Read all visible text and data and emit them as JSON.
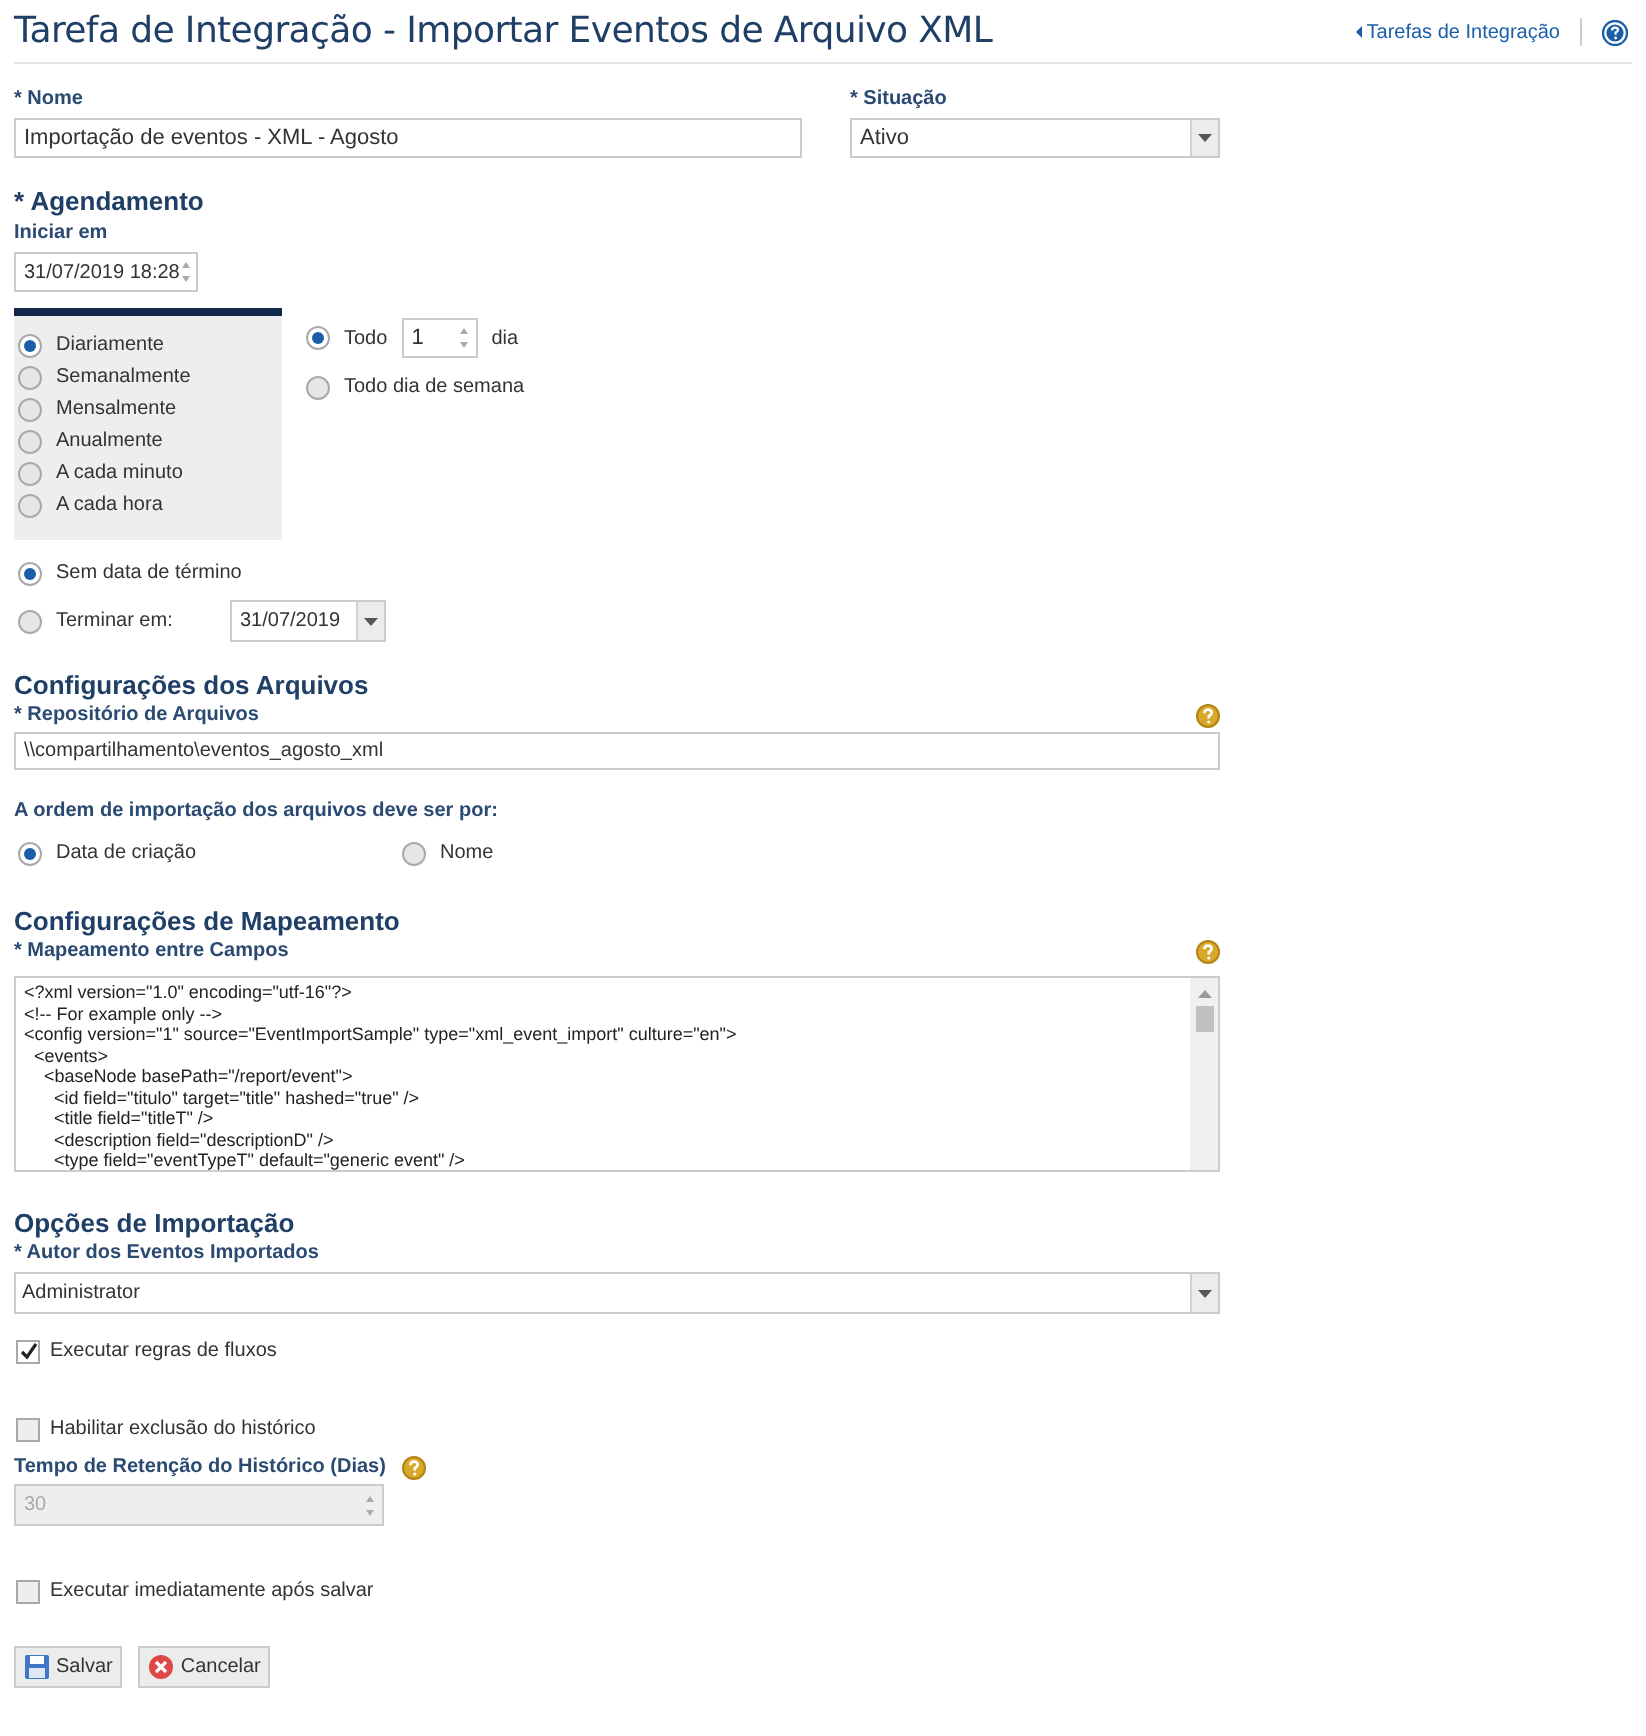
{
  "header": {
    "title": "Tarefa de Integração - Importar Eventos de Arquivo XML",
    "back_link": "Tarefas de Integração"
  },
  "name_field": {
    "label": "* Nome",
    "value": "Importação de eventos - XML - Agosto"
  },
  "status_field": {
    "label": "* Situação",
    "value": "Ativo"
  },
  "schedule": {
    "heading": "* Agendamento",
    "start_label": "Iniciar em",
    "start_value": "31/07/2019 18:28",
    "frequencies": [
      {
        "label": "Diariamente",
        "selected": true
      },
      {
        "label": "Semanalmente",
        "selected": false
      },
      {
        "label": "Mensalmente",
        "selected": false
      },
      {
        "label": "Anualmente",
        "selected": false
      },
      {
        "label": "A cada minuto",
        "selected": false
      },
      {
        "label": "A cada hora",
        "selected": false
      }
    ],
    "daily_options": [
      {
        "kind": "interval",
        "label": "Todo",
        "value": "1",
        "unit": "dia",
        "selected": true
      },
      {
        "kind": "plain",
        "label": "Todo dia de semana",
        "selected": false
      }
    ],
    "end_options": [
      {
        "kind": "plain",
        "label": "Sem data de término",
        "selected": true
      },
      {
        "kind": "date",
        "label": "Terminar em:",
        "value": "31/07/2019",
        "selected": false
      }
    ]
  },
  "files": {
    "heading": "Configurações dos Arquivos",
    "repository_label": "* Repositório de Arquivos",
    "repository_value": "\\\\compartilhamento\\eventos_agosto_xml",
    "order_label": "A ordem de importação dos arquivos deve ser por:",
    "order_options": [
      {
        "label": "Data de criação",
        "selected": true
      },
      {
        "label": "Nome",
        "selected": false
      }
    ]
  },
  "mapping": {
    "heading": "Configurações de Mapeamento",
    "label": "* Mapeamento entre Campos",
    "lines": [
      "<?xml version=\"1.0\" encoding=\"utf-16\"?>",
      "<!-- For example only -->",
      "<config version=\"1\" source=\"EventImportSample\" type=\"xml_event_import\" culture=\"en\">",
      "  <events>",
      "    <baseNode basePath=\"/report/event\">",
      "      <id field=\"titulo\" target=\"title\" hashed=\"true\" />",
      "      <title field=\"titleT\" />",
      "      <description field=\"descriptionD\" />",
      "      <type field=\"eventTypeT\" default=\"generic event\" />"
    ]
  },
  "import_options": {
    "heading": "Opções de Importação",
    "author_label": "* Autor dos Eventos Importados",
    "author_value": "Administrator",
    "run_flow_rules": {
      "label": "Executar regras de fluxos",
      "checked": true
    },
    "enable_history_deletion": {
      "label": "Habilitar exclusão do histórico",
      "checked": false
    },
    "retention": {
      "label": "Tempo de Retenção do Histórico (Dias)",
      "value": "30",
      "disabled": true
    },
    "run_after_save": {
      "label": "Executar imediatamente após salvar",
      "checked": false
    }
  },
  "buttons": [
    {
      "kind": "save",
      "label": "Salvar"
    },
    {
      "kind": "cancel",
      "label": "Cancelar"
    }
  ]
}
